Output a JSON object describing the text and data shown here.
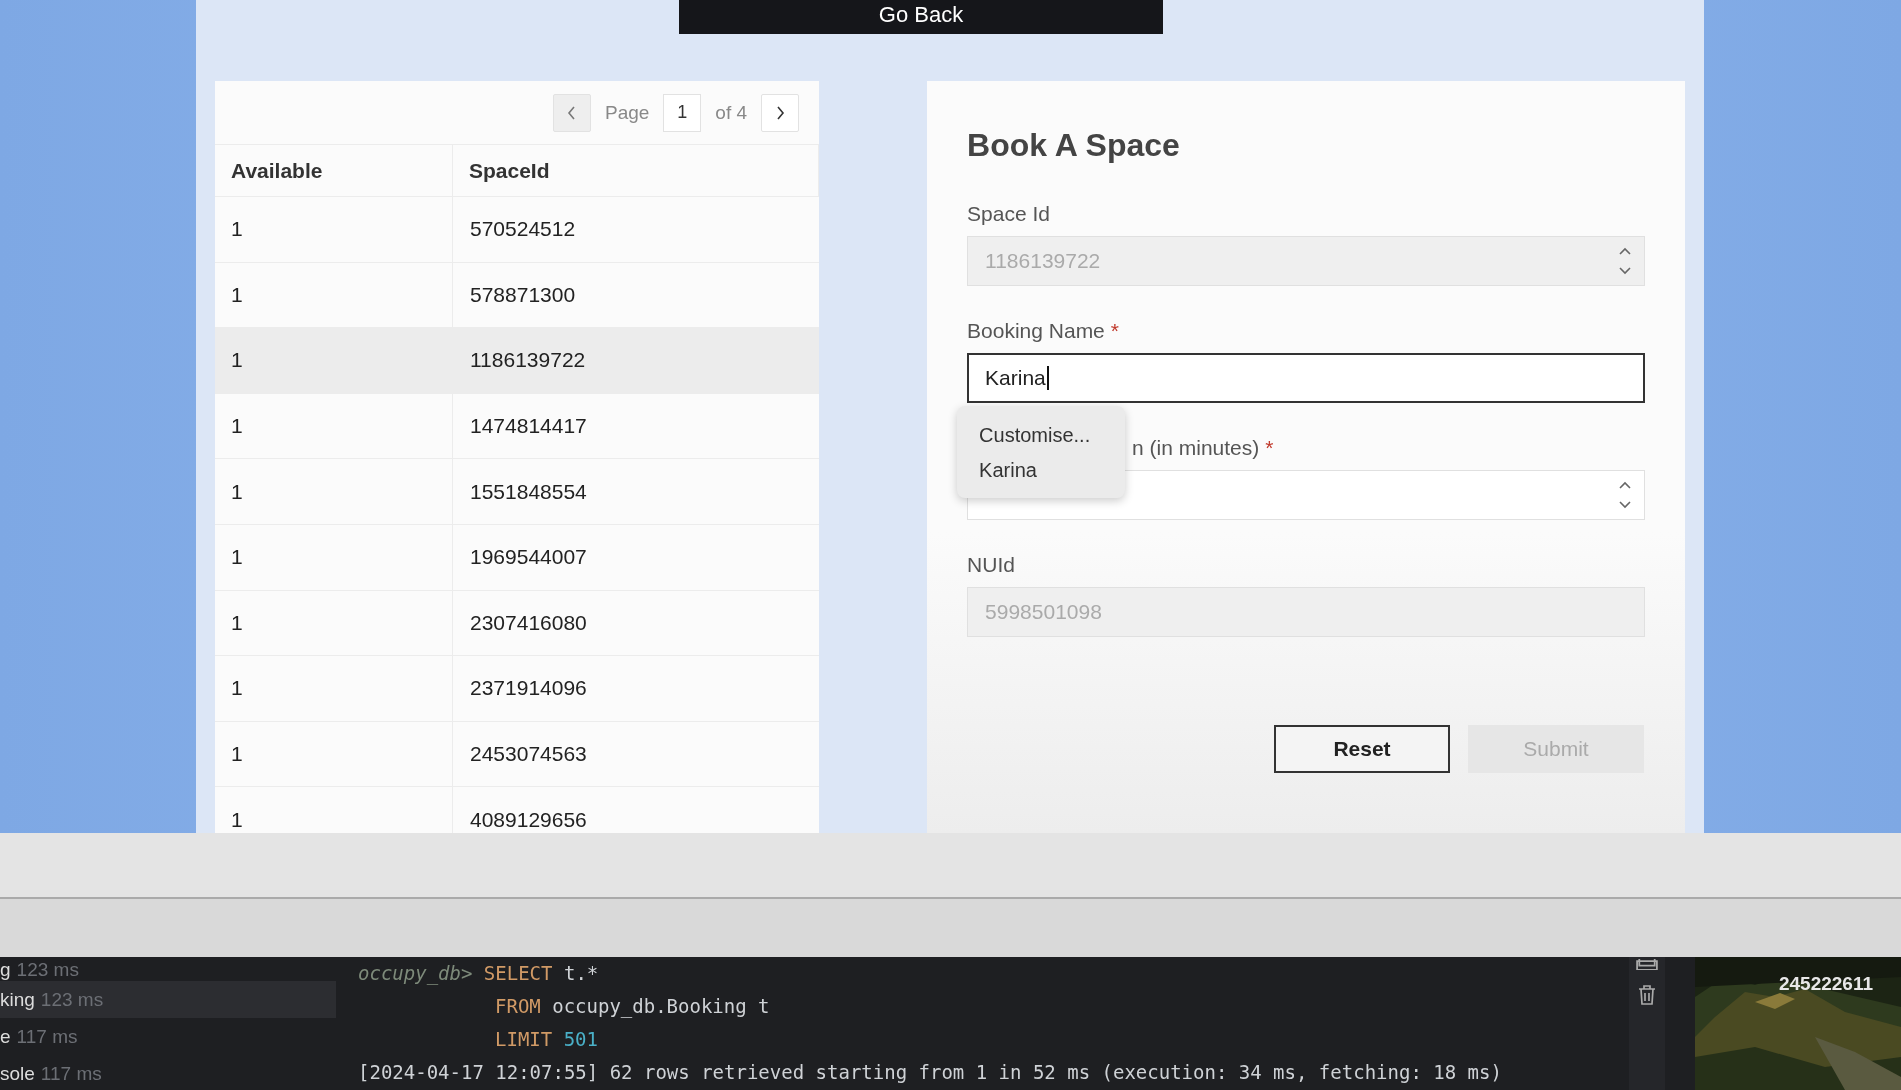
{
  "header": {
    "back_button": "Go Back"
  },
  "spaces_table": {
    "pagination": {
      "page_label": "Page",
      "page": "1",
      "total": "of 4"
    },
    "columns": [
      "Available",
      "SpaceId"
    ],
    "rows": [
      {
        "cells": [
          "1",
          "570524512"
        ],
        "selected": false
      },
      {
        "cells": [
          "1",
          "578871300"
        ],
        "selected": false
      },
      {
        "cells": [
          "1",
          "1186139722"
        ],
        "selected": true
      },
      {
        "cells": [
          "1",
          "1474814417"
        ],
        "selected": false
      },
      {
        "cells": [
          "1",
          "1551848554"
        ],
        "selected": false
      },
      {
        "cells": [
          "1",
          "1969544007"
        ],
        "selected": false
      },
      {
        "cells": [
          "1",
          "2307416080"
        ],
        "selected": false
      },
      {
        "cells": [
          "1",
          "2371914096"
        ],
        "selected": false
      },
      {
        "cells": [
          "1",
          "2453074563"
        ],
        "selected": false
      },
      {
        "cells": [
          "1",
          "4089129656"
        ],
        "selected": false
      }
    ]
  },
  "booking_form": {
    "title": "Book A Space",
    "fields": [
      {
        "kind": "number",
        "label": "Space Id",
        "value": "1186139722",
        "disabled": true,
        "focused": false,
        "covered": false
      },
      {
        "kind": "text",
        "label": "Booking Name",
        "required_mark": "*",
        "value": "Karina",
        "disabled": false,
        "focused": true,
        "covered": false
      },
      {
        "kind": "number",
        "label": "n (in minutes)",
        "required_mark": "*",
        "disabled": false,
        "focused": false,
        "covered": true
      },
      {
        "kind": "text",
        "label": "NUId",
        "value": "5998501098",
        "disabled": true,
        "focused": false,
        "covered": false
      }
    ],
    "autocomplete": [
      "Customise...",
      "Karina"
    ],
    "buttons": [
      {
        "label": "Reset",
        "disabled": false
      },
      {
        "label": "Submit",
        "disabled": true
      }
    ]
  },
  "console": {
    "sessions": [
      {
        "name": "g",
        "time": "123 ms",
        "selected": false
      },
      {
        "name": "king",
        "time": "123 ms",
        "selected": true
      },
      {
        "name": "e",
        "time": "117 ms",
        "selected": false
      },
      {
        "name": "sole",
        "time": "117 ms",
        "selected": false
      }
    ],
    "lines": [
      {
        "kind": "query",
        "tokens": [
          {
            "kind": "prompt",
            "text": "occupy_db>"
          },
          {
            "kind": "keyword",
            "text": "SELECT"
          },
          {
            "kind": "plain",
            "text": "t.*"
          }
        ]
      },
      {
        "kind": "continuation",
        "tokens": [
          {
            "kind": "keyword",
            "text": "FROM"
          },
          {
            "kind": "plain",
            "text": "occupy_db.Booking t"
          }
        ]
      },
      {
        "kind": "continuation",
        "tokens": [
          {
            "kind": "keyword",
            "text": "LIMIT"
          },
          {
            "kind": "number",
            "text": "501"
          }
        ]
      },
      {
        "kind": "log",
        "tokens": [
          {
            "kind": "plain",
            "text": "[2024-04-17 12:07:55] 62 rows retrieved starting from 1 in 52 ms (execution: 34 ms, fetching: 18 ms)"
          }
        ]
      }
    ],
    "overlay_number": "245222611"
  }
}
